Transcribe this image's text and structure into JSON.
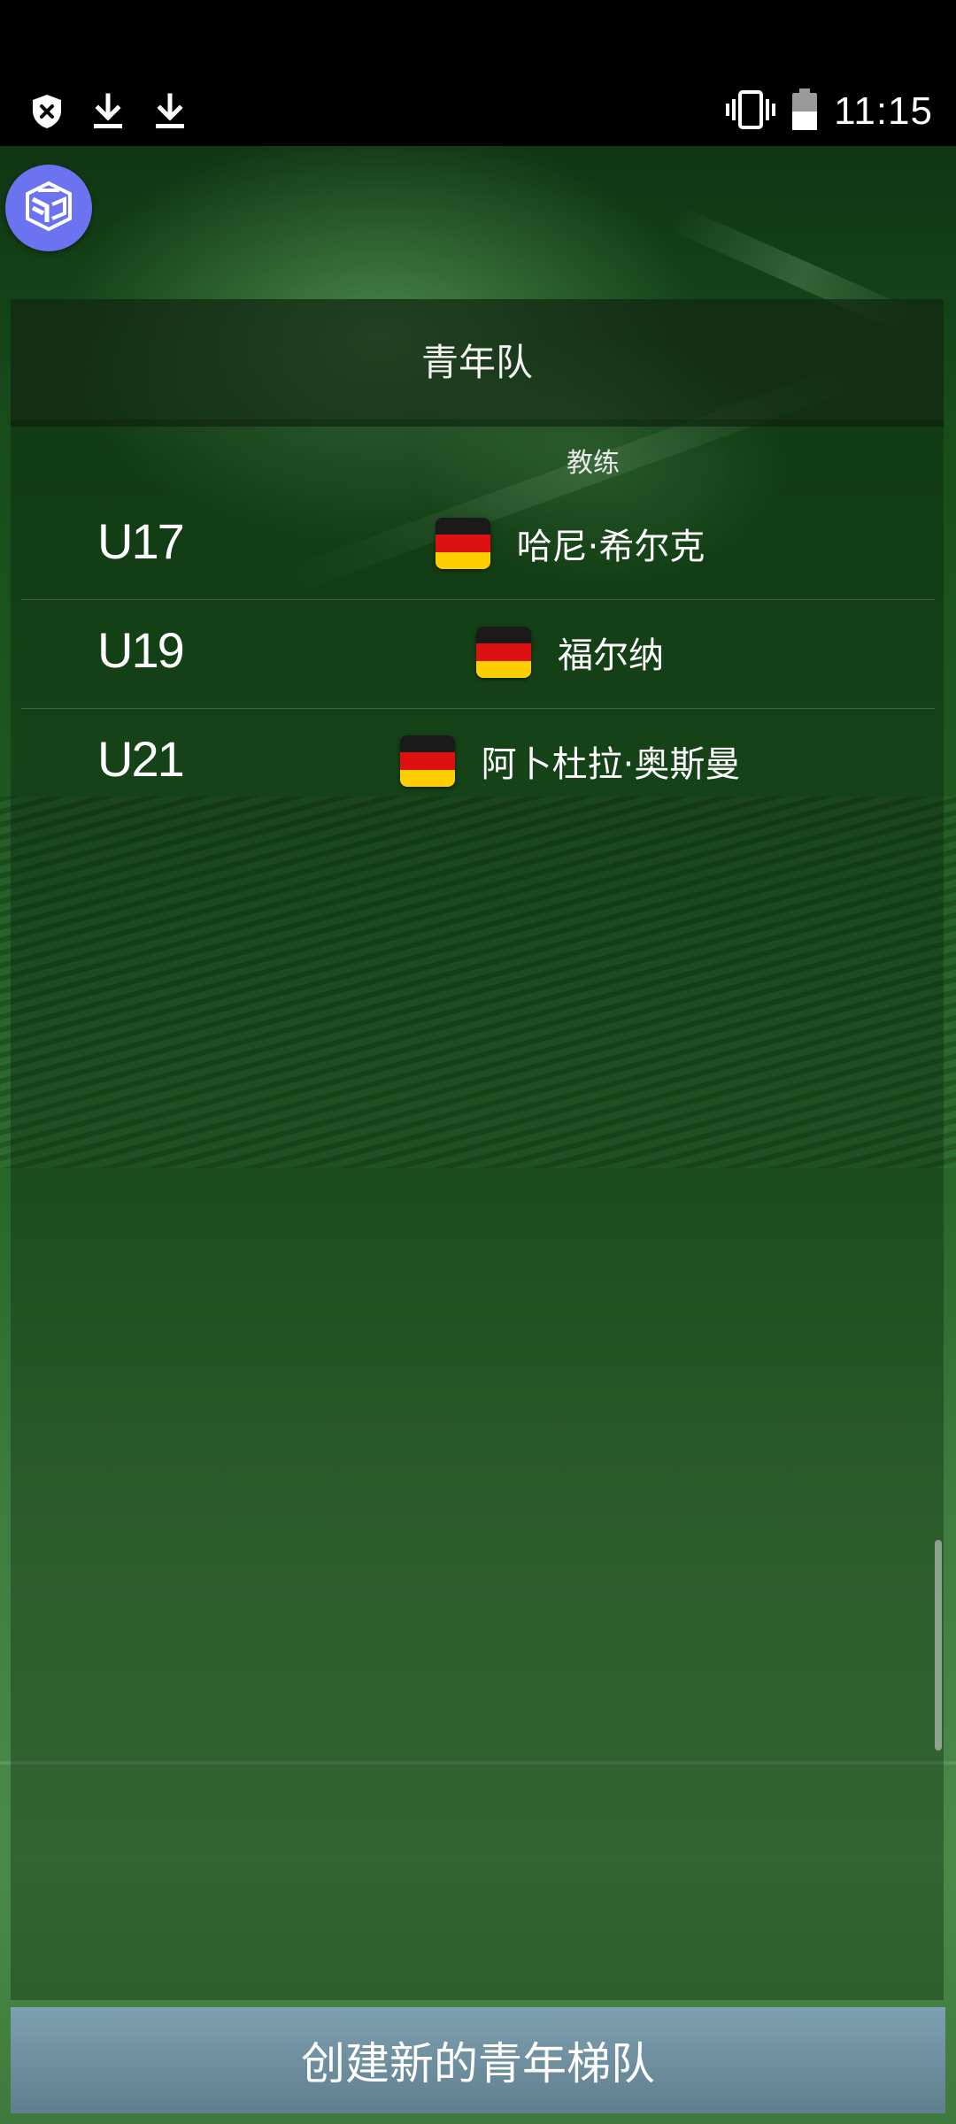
{
  "status_bar": {
    "time": "11:15",
    "left_icons": [
      "shield-x-icon",
      "download-icon",
      "download-icon"
    ],
    "right_icons": [
      "vibrate-icon",
      "battery-icon"
    ]
  },
  "app": {
    "icon": "cube-logo-icon",
    "accent_color": "#6b73f0"
  },
  "panel": {
    "title": "青年队",
    "coach_header": "教练"
  },
  "teams": [
    {
      "code": "U17",
      "coach": "哈尼·希尔克",
      "flag": "germany-flag-icon"
    },
    {
      "code": "U19",
      "coach": "福尔纳",
      "flag": "germany-flag-icon"
    },
    {
      "code": "U21",
      "coach": "阿卜杜拉·奥斯曼",
      "flag": "germany-flag-icon"
    }
  ],
  "flag_colors": [
    "#1a1a1a",
    "#dd1111",
    "#ffce00"
  ],
  "footer": {
    "create_button_label": "创建新的青年梯队",
    "button_color": "#6f8fa0"
  }
}
